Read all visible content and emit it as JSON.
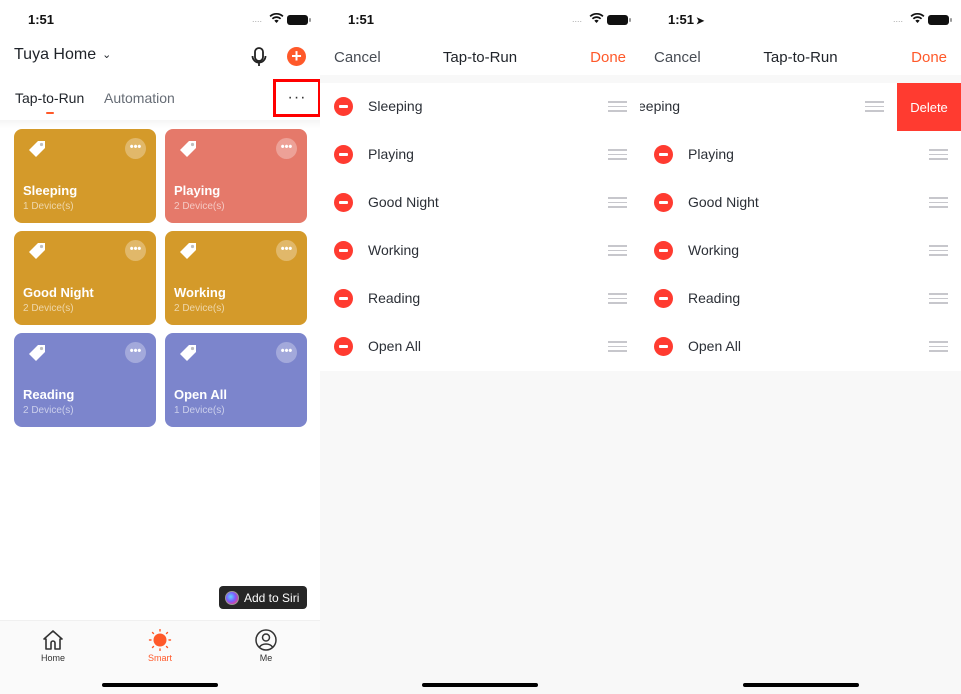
{
  "status_bar": {
    "panels": [
      {
        "time": "1:51",
        "location_arrow": false
      },
      {
        "time": "1:51",
        "location_arrow": false
      },
      {
        "time": "1:51",
        "location_arrow": true
      }
    ],
    "signal": "....",
    "location_icon": "➤"
  },
  "smart_screen": {
    "home_name": "Tuya Home",
    "home_chevron": "⌄",
    "add_icon": "+",
    "tabs": [
      {
        "label": "Tap-to-Run",
        "active": true
      },
      {
        "label": "Automation",
        "active": false
      }
    ],
    "more_icon": "···",
    "scenes": [
      {
        "name": "Sleeping",
        "devices": "1 Device(s)",
        "color": "#d49a2a"
      },
      {
        "name": "Playing",
        "devices": "2 Device(s)",
        "color": "#e5796a"
      },
      {
        "name": "Good Night",
        "devices": "2 Device(s)",
        "color": "#d49a2a"
      },
      {
        "name": "Working",
        "devices": "2 Device(s)",
        "color": "#d49a2a"
      },
      {
        "name": "Reading",
        "devices": "2 Device(s)",
        "color": "#7c85cc"
      },
      {
        "name": "Open All",
        "devices": "1 Device(s)",
        "color": "#7c85cc"
      }
    ],
    "card_more_icon": "•••",
    "siri_button": "Add to Siri",
    "bottom_nav": [
      {
        "label": "Home",
        "icon": "home-icon",
        "active": false
      },
      {
        "label": "Smart",
        "icon": "sun-icon",
        "active": true
      },
      {
        "label": "Me",
        "icon": "person-icon",
        "active": false
      }
    ]
  },
  "edit_screen": {
    "cancel": "Cancel",
    "title": "Tap-to-Run",
    "done": "Done",
    "items": [
      "Sleeping",
      "Playing",
      "Good Night",
      "Working",
      "Reading",
      "Open All"
    ]
  },
  "swipe_screen": {
    "cancel": "Cancel",
    "title": "Tap-to-Run",
    "done": "Done",
    "swiped_item_partial": "eeping",
    "delete_label": "Delete",
    "items": [
      "Sleeping",
      "Playing",
      "Good Night",
      "Working",
      "Reading",
      "Open All"
    ]
  },
  "colors": {
    "accent": "#ff592a",
    "delete_red": "#ff3b30",
    "highlight_box": "#ff0000"
  }
}
